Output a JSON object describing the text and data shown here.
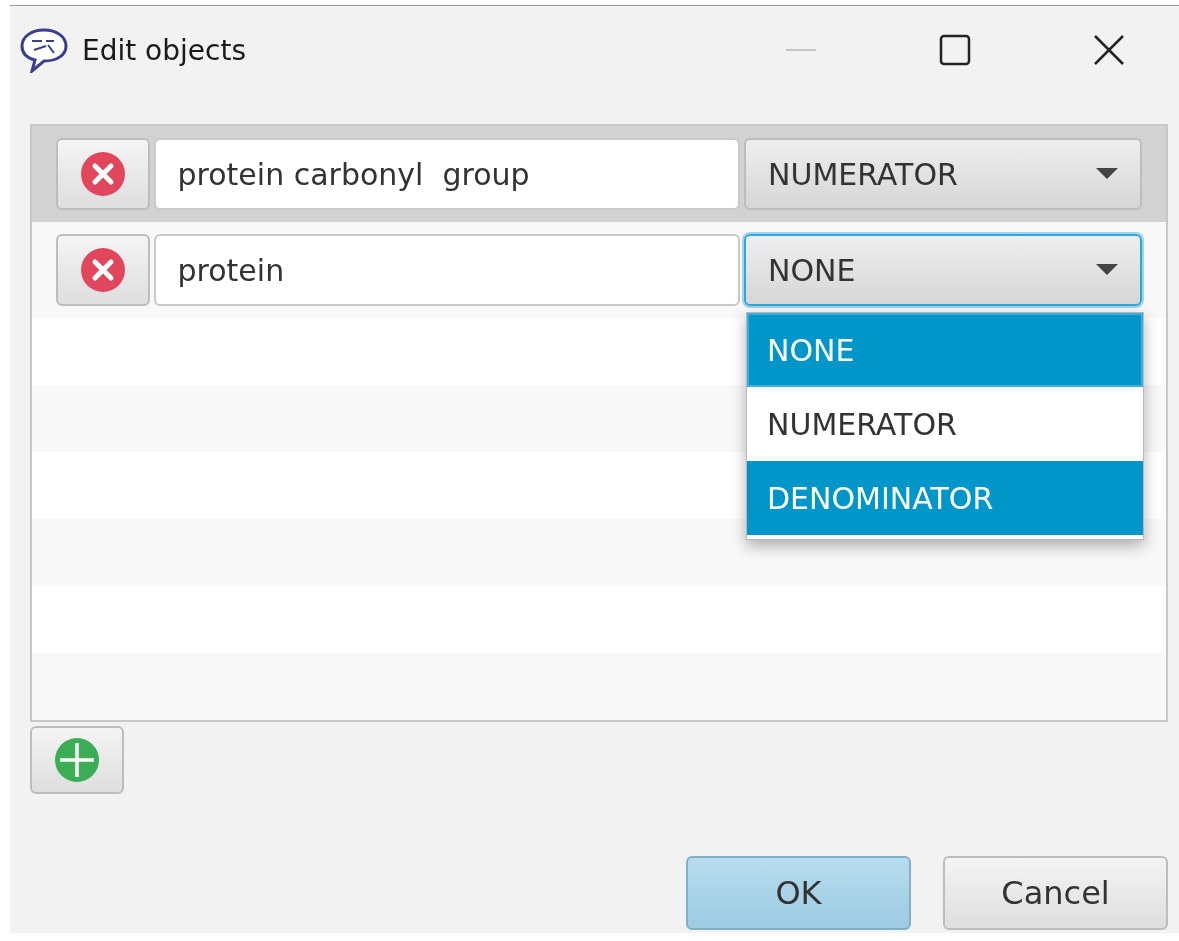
{
  "window": {
    "title": "Edit objects"
  },
  "rows": [
    {
      "name": "protein carbonyl  group",
      "role": "NUMERATOR",
      "selected": true,
      "focused": false
    },
    {
      "name": "protein",
      "role": "NONE",
      "selected": false,
      "focused": true,
      "open": true
    }
  ],
  "dropdown": {
    "items": [
      {
        "label": "NONE",
        "selected": true,
        "highlighted": true
      },
      {
        "label": "NUMERATOR",
        "selected": false,
        "highlighted": false
      },
      {
        "label": "DENOMINATOR",
        "selected": false,
        "highlighted": true
      }
    ]
  },
  "buttons": [
    {
      "label": "OK",
      "kind": "default"
    },
    {
      "label": "Cancel",
      "kind": "normal"
    }
  ]
}
